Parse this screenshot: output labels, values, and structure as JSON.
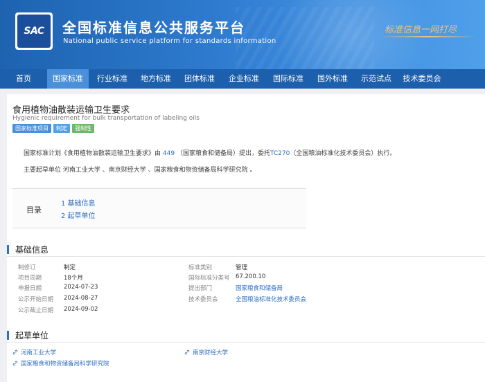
{
  "header": {
    "logo_text": "SAC",
    "title_cn": "全国标准信息公共服务平台",
    "title_en": "National public service platform  for standards information",
    "slogan": "标准信息一网打尽"
  },
  "nav": [
    {
      "label": "首页"
    },
    {
      "label": "国家标准",
      "active": true
    },
    {
      "label": "行业标准"
    },
    {
      "label": "地方标准"
    },
    {
      "label": "团体标准"
    },
    {
      "label": "企业标准"
    },
    {
      "label": "国际标准"
    },
    {
      "label": "国外标准"
    },
    {
      "label": "示范试点"
    },
    {
      "label": "技术委员会"
    }
  ],
  "standard": {
    "title": "食用植物油散装运输卫生要求",
    "subtitle": "Hygienic requirement for bulk transportation of labeling oils",
    "tags": [
      "国家标准项目",
      "制定",
      "强制性"
    ],
    "plan_prefix": "国家标准计划《食用植物油散装运输卫生要求》由",
    "plan_dept_code": "449",
    "plan_middle": "（国家粮食和储备局）提出，委托",
    "plan_tc_code": "TC270",
    "plan_suffix": "（全国粮油标准化技术委员会）执行。",
    "drafters_text": "主要起草单位 河南工业大学 、南京财经大学 、国家粮食和物资储备局科学研究院 。"
  },
  "toc": {
    "label": "目录",
    "items": [
      "1  基础信息",
      "2  起草单位"
    ]
  },
  "basic_info": {
    "section_title": "基础信息",
    "left": [
      {
        "key": "制修订",
        "value": "制定"
      },
      {
        "key": "项目周期",
        "value": "18个月"
      },
      {
        "key": "申报日期",
        "value": "2024-07-23"
      },
      {
        "key": "公示开始日期",
        "value": "2024-08-27"
      },
      {
        "key": "公示截止日期",
        "value": "2024-09-02"
      }
    ],
    "right": [
      {
        "key": "标准类别",
        "value": "管理"
      },
      {
        "key": "国际标准分类号",
        "value": "67.200.10"
      },
      {
        "key": "提出部门",
        "value": "国家粮食和储备局"
      },
      {
        "key": "技术委员会",
        "value": "全国粮油标准化技术委员会"
      }
    ]
  },
  "drafting_units": {
    "section_title": "起草单位",
    "units": [
      "河南工业大学",
      "南京财经大学",
      "国家粮食和物资储备局科学研究院"
    ]
  },
  "colors": {
    "header_blue": "#1d63b0",
    "nav_blue": "#1c5fac",
    "nav_active": "#4a8fd9",
    "link_blue": "#2f6fc0",
    "slogan_gold": "#f0c673"
  }
}
